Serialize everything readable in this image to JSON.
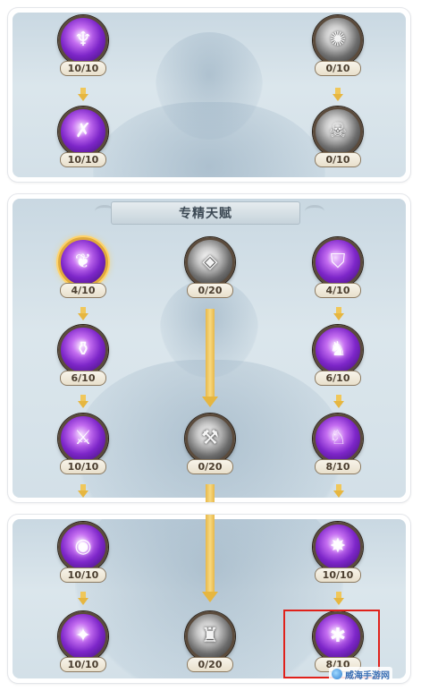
{
  "panel_top": {
    "left_column": [
      {
        "points": "10/10",
        "icon": "purple-spirit-icon",
        "glyph": "♆"
      },
      {
        "points": "10/10",
        "icon": "purple-crossed-blades-icon",
        "glyph": "✗"
      }
    ],
    "right_column": [
      {
        "points": "0/10",
        "icon": "grey-gear-icon",
        "glyph": "✺"
      },
      {
        "points": "0/10",
        "icon": "grey-demon-mask-icon",
        "glyph": "☠"
      }
    ]
  },
  "panel_middle": {
    "title": "专精天赋",
    "left_column": [
      {
        "points": "4/10",
        "icon": "purple-flame-leaf-icon",
        "glyph": "❦",
        "highlighted": true
      },
      {
        "points": "6/10",
        "icon": "purple-orb-vessel-icon",
        "glyph": "⚱"
      },
      {
        "points": "10/10",
        "icon": "purple-claw-strike-icon",
        "glyph": "⚔"
      }
    ],
    "center_column": [
      {
        "points": "0/20",
        "icon": "grey-crystal-shard-icon",
        "glyph": "◈"
      },
      {
        "points": "0/20",
        "icon": "grey-anvil-icon",
        "glyph": "⚒"
      }
    ],
    "right_column": [
      {
        "points": "4/10",
        "icon": "purple-shield-icon",
        "glyph": "⛉"
      },
      {
        "points": "6/10",
        "icon": "purple-charging-beast-icon",
        "glyph": "♞"
      },
      {
        "points": "8/10",
        "icon": "purple-wolf-icon",
        "glyph": "♘"
      }
    ]
  },
  "panel_bottom": {
    "left_column": [
      {
        "points": "10/10",
        "icon": "purple-eye-icon",
        "glyph": "◉"
      },
      {
        "points": "10/10",
        "icon": "purple-phoenix-icon",
        "glyph": "✦"
      }
    ],
    "center_column": [
      {
        "points": "0/20",
        "icon": "grey-beast-head-icon",
        "glyph": "♜"
      }
    ],
    "right_column": [
      {
        "points": "10/10",
        "icon": "purple-shield-burst-icon",
        "glyph": "✸"
      },
      {
        "points": "8/10",
        "icon": "purple-spider-icon",
        "glyph": "✱"
      }
    ]
  },
  "watermark": {
    "text": "威海手游网",
    "icon": "site-logo-icon"
  },
  "colors": {
    "arrow": "#e6b640",
    "highlight_box": "#e0211b",
    "active_orb": "#7d26c9",
    "inactive_orb": "#6d6d6d"
  }
}
